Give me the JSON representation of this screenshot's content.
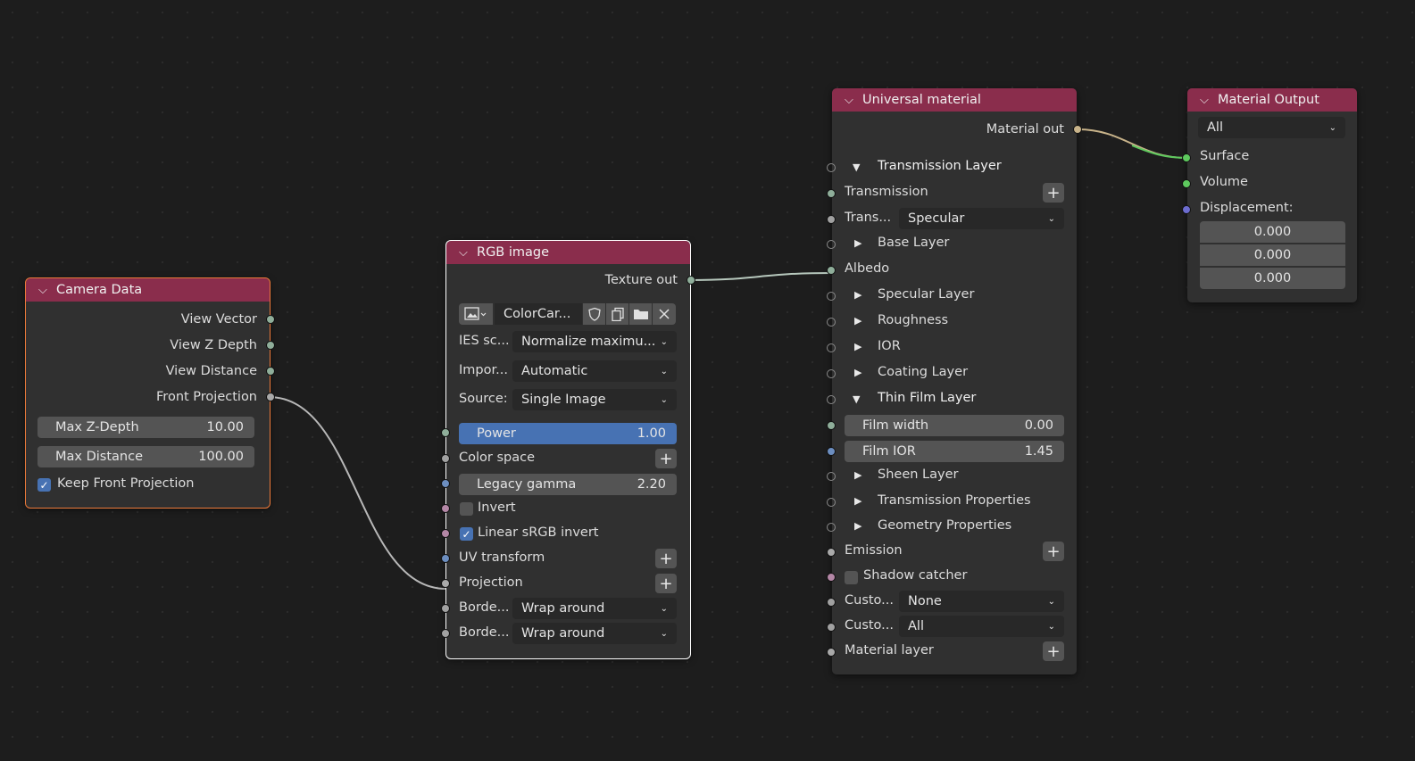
{
  "camera_data": {
    "title": "Camera Data",
    "outputs": [
      "View Vector",
      "View Z Depth",
      "View Distance",
      "Front Projection"
    ],
    "max_z_depth": {
      "label": "Max Z-Depth",
      "value": "10.00"
    },
    "max_distance": {
      "label": "Max Distance",
      "value": "100.00"
    },
    "keep_front_projection": {
      "label": "Keep Front Projection",
      "checked": true
    }
  },
  "rgb_image": {
    "title": "RGB image",
    "output": "Texture out",
    "image_name": "ColorCar...",
    "ies_label": "IES sc...",
    "ies_value": "Normalize maximu...",
    "import_label": "Impor...",
    "import_value": "Automatic",
    "source_label": "Source:",
    "source_value": "Single Image",
    "power": {
      "label": "Power",
      "value": "1.00"
    },
    "color_space": "Color space",
    "legacy_gamma": {
      "label": "Legacy gamma",
      "value": "2.20"
    },
    "invert": {
      "label": "Invert",
      "checked": false
    },
    "linear_srgb_invert": {
      "label": "Linear sRGB invert",
      "checked": true
    },
    "uv_transform": "UV transform",
    "projection": "Projection",
    "border1_label": "Borde...",
    "border1_value": "Wrap around",
    "border2_label": "Borde...",
    "border2_value": "Wrap around"
  },
  "universal_material": {
    "title": "Universal material",
    "output": "Material out",
    "transmission_layer": "Transmission Layer",
    "transmission": "Transmission",
    "trans_type_label": "Trans...",
    "trans_type_value": "Specular",
    "base_layer": "Base Layer",
    "albedo": "Albedo",
    "specular_layer": "Specular Layer",
    "roughness": "Roughness",
    "ior": "IOR",
    "coating_layer": "Coating Layer",
    "thin_film_layer": "Thin Film Layer",
    "film_width": {
      "label": "Film width",
      "value": "0.00"
    },
    "film_ior": {
      "label": "Film IOR",
      "value": "1.45"
    },
    "sheen_layer": "Sheen Layer",
    "transmission_properties": "Transmission Properties",
    "geometry_properties": "Geometry Properties",
    "emission": "Emission",
    "shadow_catcher": {
      "label": "Shadow catcher",
      "checked": false
    },
    "custom1_label": "Custo...",
    "custom1_value": "None",
    "custom2_label": "Custo...",
    "custom2_value": "All",
    "material_layer": "Material layer"
  },
  "material_output": {
    "title": "Material Output",
    "target": "All",
    "surface": "Surface",
    "volume": "Volume",
    "displacement": "Displacement:",
    "displacement_values": [
      "0.000",
      "0.000",
      "0.000"
    ]
  },
  "colors": {
    "header": "#8a2d4c",
    "socket_vector": "#8fae9a",
    "socket_float": "#a1a1a1",
    "socket_shader": "#5ec95e",
    "socket_int": "#6c6ccf",
    "socket_texture": "#b487a6",
    "selection_active": "#ffffff",
    "selection": "#ed7a3a"
  }
}
